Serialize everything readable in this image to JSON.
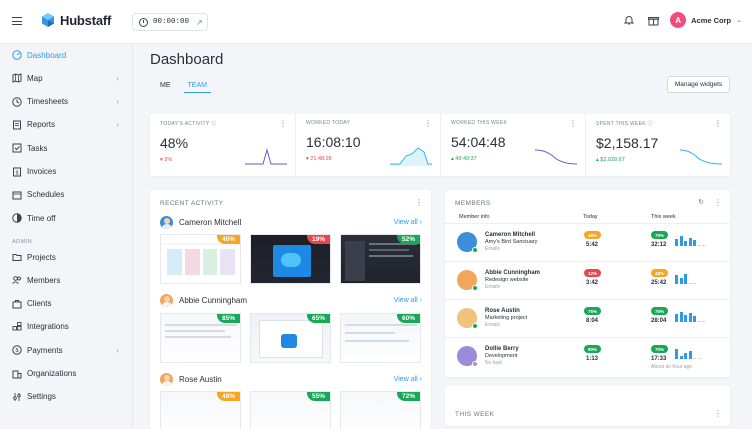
{
  "app": {
    "name": "Hubstaff"
  },
  "timer": {
    "value": "00:00:00"
  },
  "org": {
    "initial": "A",
    "name": "Acme Corp"
  },
  "colors": {
    "accent": "#2e9ae6",
    "danger": "#e5484d",
    "success": "#18a957",
    "warning": "#f5a623",
    "org": "#f04d7c"
  },
  "sidebar": {
    "items": [
      {
        "label": "Dashboard",
        "icon": "dashboard-icon",
        "active": true
      },
      {
        "label": "Map",
        "icon": "map-icon",
        "chevron": true
      },
      {
        "label": "Timesheets",
        "icon": "clock-icon",
        "chevron": true
      },
      {
        "label": "Reports",
        "icon": "reports-icon",
        "chevron": true
      },
      {
        "label": "Tasks",
        "icon": "tasks-icon"
      },
      {
        "label": "Invoices",
        "icon": "invoice-icon"
      },
      {
        "label": "Schedules",
        "icon": "calendar-icon"
      },
      {
        "label": "Time off",
        "icon": "time-off-icon"
      }
    ],
    "section_label": "ADMIN",
    "admin_items": [
      {
        "label": "Projects",
        "icon": "folder-icon"
      },
      {
        "label": "Members",
        "icon": "members-icon"
      },
      {
        "label": "Clients",
        "icon": "clients-icon"
      },
      {
        "label": "Integrations",
        "icon": "integrations-icon"
      },
      {
        "label": "Payments",
        "icon": "payments-icon",
        "chevron": true
      },
      {
        "label": "Organizations",
        "icon": "organizations-icon"
      },
      {
        "label": "Settings",
        "icon": "settings-icon"
      }
    ]
  },
  "main": {
    "title": "Dashboard",
    "tabs": [
      {
        "label": "ME"
      },
      {
        "label": "TEAM",
        "active": true
      }
    ],
    "manage_label": "Manage widgets"
  },
  "stats": [
    {
      "label": "TODAY'S ACTIVITY",
      "value": "48%",
      "change": "2%",
      "direction": "down",
      "info": true
    },
    {
      "label": "WORKED TODAY",
      "value": "16:08:10",
      "change": "21:48:28",
      "direction": "down"
    },
    {
      "label": "WORKED THIS WEEK",
      "value": "54:04:48",
      "change": "49:40:37",
      "direction": "up"
    },
    {
      "label": "SPENT THIS WEEK",
      "value": "$2,158.17",
      "change": "$2,029.67",
      "direction": "up",
      "info": true
    }
  ],
  "recent_activity": {
    "title": "RECENT ACTIVITY",
    "view_all": "View all",
    "people": [
      {
        "name": "Cameron Mitchell",
        "shots": [
          {
            "pct": "40%",
            "color": "#f5a623"
          },
          {
            "pct": "19%",
            "color": "#e5484d"
          },
          {
            "pct": "52%",
            "color": "#18a957"
          }
        ]
      },
      {
        "name": "Abbie Cunningham",
        "shots": [
          {
            "pct": "85%",
            "color": "#18a957"
          },
          {
            "pct": "65%",
            "color": "#18a957"
          },
          {
            "pct": "60%",
            "color": "#18a957"
          }
        ]
      },
      {
        "name": "Rose Austin",
        "shots": [
          {
            "pct": "48%",
            "color": "#f5a623"
          },
          {
            "pct": "55%",
            "color": "#18a957"
          },
          {
            "pct": "72%",
            "color": "#18a957"
          }
        ]
      }
    ]
  },
  "members": {
    "title": "MEMBERS",
    "headers": {
      "info": "Member info",
      "today": "Today",
      "week": "This week"
    },
    "rows": [
      {
        "name": "Cameron Mitchell",
        "project": "Amy's Bird Sanctuary",
        "task": "Emails",
        "today_pct": "46%",
        "today_color": "#f5a623",
        "today_time": "5:42",
        "week_pct": "75%",
        "week_color": "#18a957",
        "week_time": "32:12",
        "bars": [
          0.7,
          1.0,
          0.5,
          0.8,
          0.6
        ]
      },
      {
        "name": "Abbie Cunningham",
        "project": "Redesign website",
        "task": "Emails",
        "today_pct": "12%",
        "today_color": "#e5484d",
        "today_time": "3:42",
        "week_pct": "48%",
        "week_color": "#f5a623",
        "week_time": "25:42",
        "bars": [
          0.9,
          0.6,
          1.0
        ]
      },
      {
        "name": "Rose Austin",
        "project": "Marketing project",
        "task": "Emails",
        "today_pct": "75%",
        "today_color": "#18a957",
        "today_time": "8:04",
        "week_pct": "75%",
        "week_color": "#18a957",
        "week_time": "28:04",
        "bars": [
          0.8,
          1.0,
          0.7,
          0.9,
          0.6
        ]
      },
      {
        "name": "Dollie Berry",
        "project": "Development",
        "task": "No task",
        "today_pct": "90%",
        "today_color": "#18a957",
        "today_time": "1:13",
        "week_pct": "70%",
        "week_color": "#18a957",
        "week_time": "17:33",
        "week_sub": "About an hour ago",
        "bars": [
          1.0,
          0.3,
          0.6,
          0.8
        ]
      }
    ]
  },
  "this_week": {
    "title": "THIS WEEK"
  }
}
